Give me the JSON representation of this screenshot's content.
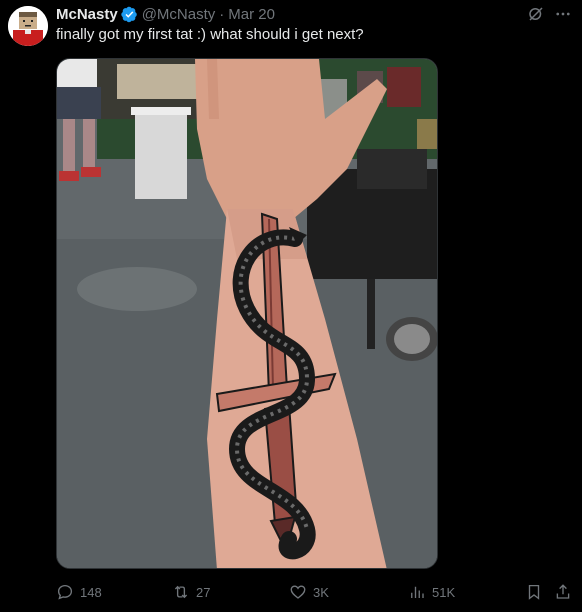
{
  "tweet": {
    "author": {
      "display_name": "McNasty",
      "handle": "@McNasty",
      "verified": true
    },
    "separator": "·",
    "date": "Mar 20",
    "text": "finally got my first tat :) what should i get next?",
    "media": {
      "type": "photo"
    },
    "actions": {
      "replies": "148",
      "reposts": "27",
      "likes": "3K",
      "views": "51K"
    }
  },
  "colors": {
    "background": "#000000",
    "text_primary": "#e7e9ea",
    "text_secondary": "#71767b",
    "verified_badge": "#1d9bf0"
  },
  "icons": [
    "verified-badge-icon",
    "grok-icon",
    "more-icon",
    "reply-icon",
    "retweet-icon",
    "like-icon",
    "views-icon",
    "bookmark-icon",
    "share-icon"
  ]
}
